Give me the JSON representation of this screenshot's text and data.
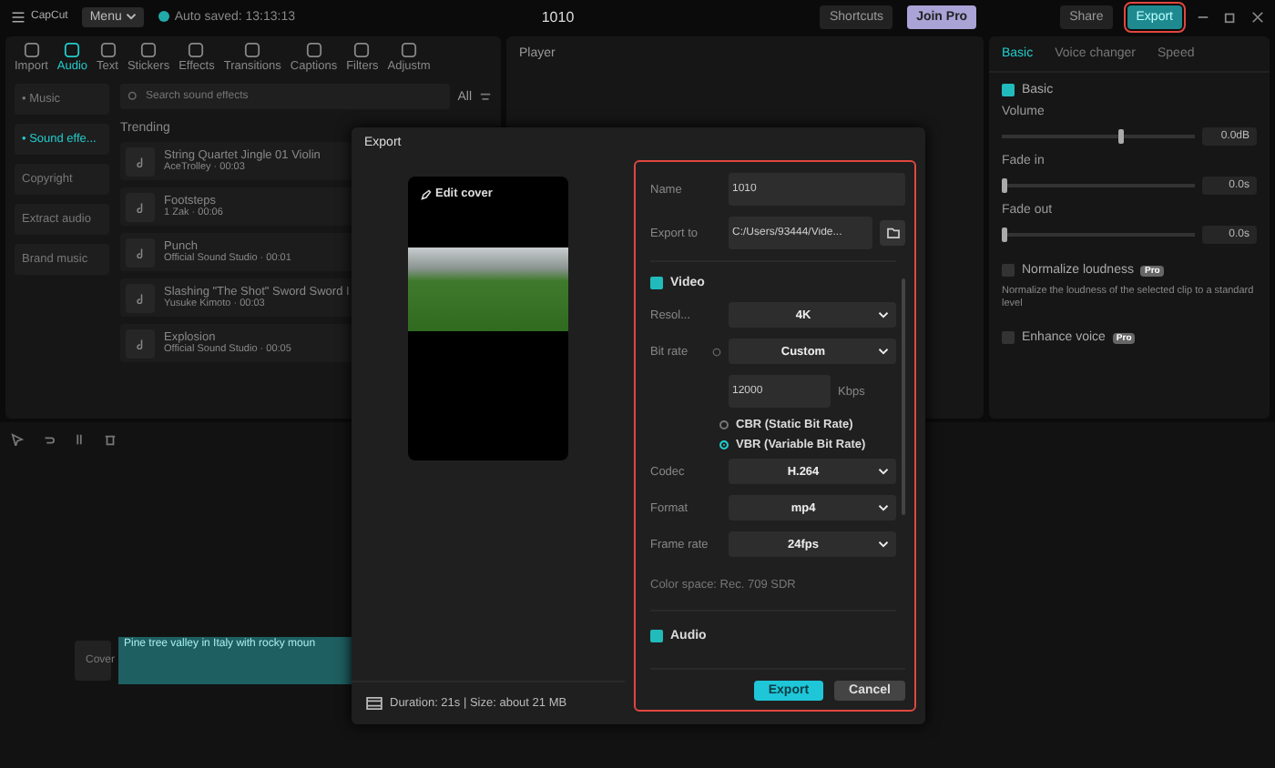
{
  "app": {
    "name": "CapCut",
    "menu": "Menu",
    "autosave": "Auto saved: 13:13:13",
    "title": "1010",
    "shortcuts": "Shortcuts",
    "join_pro": "Join Pro",
    "share": "Share",
    "export": "Export",
    "export_highlighted": true
  },
  "toolbar": [
    {
      "label": "Import",
      "selected": false
    },
    {
      "label": "Audio",
      "selected": true
    },
    {
      "label": "Text",
      "selected": false
    },
    {
      "label": "Stickers",
      "selected": false
    },
    {
      "label": "Effects",
      "selected": false
    },
    {
      "label": "Transitions",
      "selected": false
    },
    {
      "label": "Captions",
      "selected": false
    },
    {
      "label": "Filters",
      "selected": false
    },
    {
      "label": "Adjustm",
      "selected": false
    }
  ],
  "sidebar": [
    {
      "label": "• Music",
      "selected": false
    },
    {
      "label": "• Sound effe...",
      "selected": true
    },
    {
      "label": "Copyright",
      "selected": false
    },
    {
      "label": "Extract audio",
      "selected": false
    },
    {
      "label": "Brand music",
      "selected": false
    }
  ],
  "search": {
    "placeholder": "Search sound effects",
    "filter": "All"
  },
  "section_title": "Trending",
  "sounds": [
    {
      "title": "String Quartet Jingle 01 Violin",
      "subtitle": "AceTrolley · 00:03"
    },
    {
      "title": "Footsteps",
      "subtitle": "1 Zak · 00:06"
    },
    {
      "title": "Punch",
      "subtitle": "Official Sound Studio · 00:01"
    },
    {
      "title": "Slashing \"The Shot\" Sword Sword I",
      "subtitle": "Yusuke Kimoto · 00:03"
    },
    {
      "title": "Explosion",
      "subtitle": "Official Sound Studio · 00:05"
    }
  ],
  "player": {
    "title": "Player"
  },
  "inspector": {
    "tabs": [
      {
        "label": "Basic",
        "selected": true
      },
      {
        "label": "Voice changer",
        "selected": false
      },
      {
        "label": "Speed",
        "selected": false
      }
    ],
    "section": {
      "label": "Basic",
      "checked": true
    },
    "params": [
      {
        "label": "Volume",
        "value": "0.0dB",
        "level": 0.6
      },
      {
        "label": "Fade in",
        "value": "0.0s",
        "level": 0
      },
      {
        "label": "Fade out",
        "value": "0.0s",
        "level": 0
      }
    ],
    "options": [
      {
        "label": "Normalize loudness",
        "badge": "Pro",
        "checked": false,
        "description": "Normalize the loudness of the selected clip to a standard level"
      },
      {
        "label": "Enhance voice",
        "badge": "Pro",
        "checked": false
      }
    ]
  },
  "timeline": {
    "clip": "Pine tree valley in Italy with rocky moun",
    "cover": "Cover"
  },
  "dialog": {
    "title": "Export",
    "edit_cover": "Edit cover",
    "duration": "Duration: 21s | Size: about 21 MB",
    "settings_highlighted": true,
    "name": {
      "label": "Name",
      "value": "1010"
    },
    "export_to": {
      "label": "Export to",
      "value": "C:/Users/93444/Vide..."
    },
    "video": {
      "label": "Video",
      "checked": true
    },
    "rows": [
      {
        "kind": "select",
        "label": "Resol...",
        "value": "4K",
        "info": false
      },
      {
        "kind": "select",
        "label": "Bit rate",
        "value": "Custom",
        "info": true
      },
      {
        "kind": "input",
        "value": "12000",
        "unit": "Kbps"
      },
      {
        "kind": "radio",
        "label": "CBR (Static Bit Rate)",
        "selected": false
      },
      {
        "kind": "radio",
        "label": "VBR (Variable Bit Rate)",
        "selected": true
      },
      {
        "kind": "select",
        "label": "Codec",
        "value": "H.264",
        "info": false
      },
      {
        "kind": "select",
        "label": "Format",
        "value": "mp4",
        "info": false
      },
      {
        "kind": "select",
        "label": "Frame rate",
        "value": "24fps",
        "info": false
      }
    ],
    "color_space": "Color space: Rec. 709 SDR",
    "audio": {
      "label": "Audio",
      "checked": true
    },
    "buttons": [
      {
        "label": "Export",
        "kind": "primary"
      },
      {
        "label": "Cancel",
        "kind": "secondary"
      }
    ]
  }
}
